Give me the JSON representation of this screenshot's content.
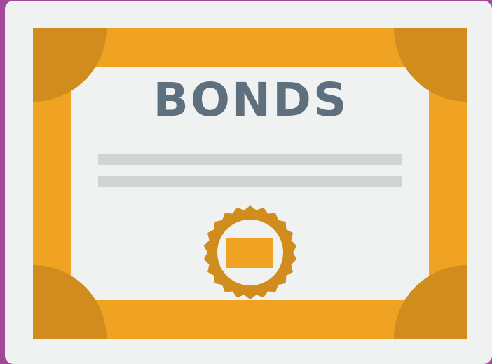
{
  "certificate": {
    "title": "BONDS",
    "text_line_count": 2
  },
  "colors": {
    "background": "#a2479a",
    "card": "#f0f2f2",
    "frame": "#f0a223",
    "frame_corners": "#d08c1c",
    "title": "#5e6f7e",
    "text_lines": "#d1d3d5",
    "seal_ring": "#d08c1c",
    "seal_center": "#f0a223"
  },
  "icons": {
    "seal": "rosette-seal-icon"
  }
}
